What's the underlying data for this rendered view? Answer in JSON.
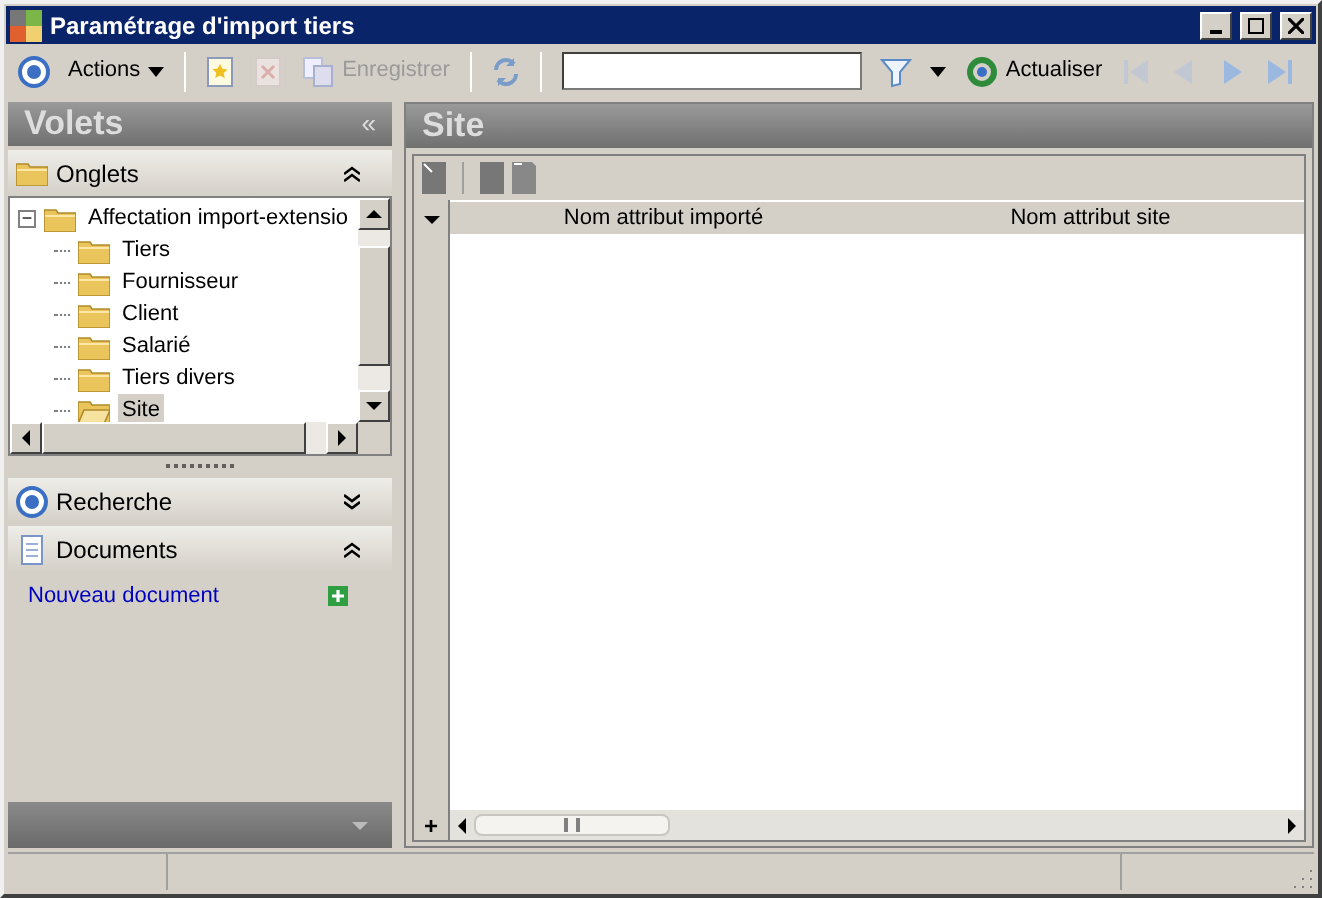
{
  "window": {
    "title": "Paramétrage d'import tiers"
  },
  "toolbar": {
    "items": [
      {
        "kind": "icon",
        "disabled": false
      },
      {
        "kind": "menu",
        "label": "Actions",
        "disabled": false
      },
      {
        "kind": "sep"
      },
      {
        "kind": "icon",
        "disabled": false
      },
      {
        "kind": "icon",
        "disabled": true
      },
      {
        "kind": "labeled",
        "label": "Enregistrer",
        "disabled": true
      },
      {
        "kind": "sep"
      },
      {
        "kind": "icon",
        "disabled": false
      },
      {
        "kind": "sep"
      },
      {
        "kind": "search",
        "value": ""
      },
      {
        "kind": "icon",
        "disabled": false
      },
      {
        "kind": "caret"
      },
      {
        "kind": "labeled",
        "label": "Actualiser",
        "disabled": false
      },
      {
        "kind": "icon",
        "disabled": true
      },
      {
        "kind": "icon",
        "disabled": true
      },
      {
        "kind": "icon",
        "disabled": false
      },
      {
        "kind": "icon",
        "disabled": false
      }
    ]
  },
  "sidebar": {
    "title": "Volets",
    "collapse_glyph": "«",
    "tree_section": {
      "title": "Onglets",
      "expanded": true,
      "tree": [
        {
          "label": "Affectation import-extensio",
          "glyph": "−",
          "expanded": true,
          "selected": false,
          "children": [
            {
              "label": "Tiers",
              "selected": false
            },
            {
              "label": "Fournisseur",
              "selected": false
            },
            {
              "label": "Client",
              "selected": false
            },
            {
              "label": "Salarié",
              "selected": false
            },
            {
              "label": "Tiers divers",
              "selected": false
            },
            {
              "label": "Site",
              "selected": true
            }
          ]
        }
      ]
    },
    "sections": [
      {
        "title": "Recherche",
        "expanded": false
      },
      {
        "title": "Documents",
        "expanded": true,
        "links": [
          "Nouveau document"
        ]
      }
    ]
  },
  "main": {
    "title": "Site",
    "add_glyph": "+",
    "table": {
      "columns": [
        "Nom attribut importé",
        "Nom attribut site"
      ]
    }
  }
}
